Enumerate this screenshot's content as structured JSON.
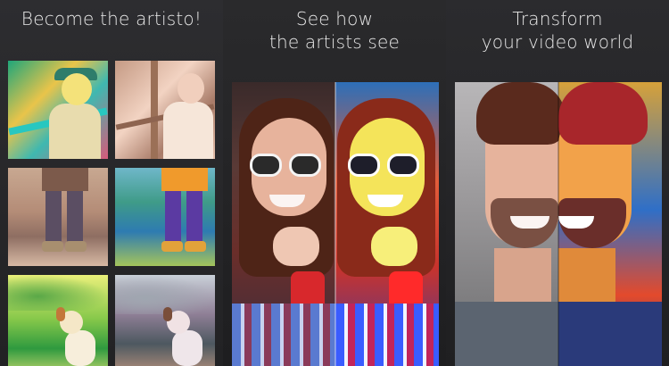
{
  "captions": {
    "panel1": "Become the artisto!",
    "panel2": "See how\nthe artists see",
    "panel3": "Transform\nyour video world"
  },
  "icons": {
    "panel1_grid": [
      "photo-girl-cap-filtered",
      "photo-girl-cap-original",
      "photo-legs-original",
      "photo-legs-filtered",
      "photo-dog-filtered",
      "photo-dog-sketch"
    ],
    "panel2": "photo-woman-sunglasses-split",
    "panel3": "photo-man-split"
  },
  "colors": {
    "background": "#1a1a1c",
    "caption_text": "#e8e8e8"
  }
}
